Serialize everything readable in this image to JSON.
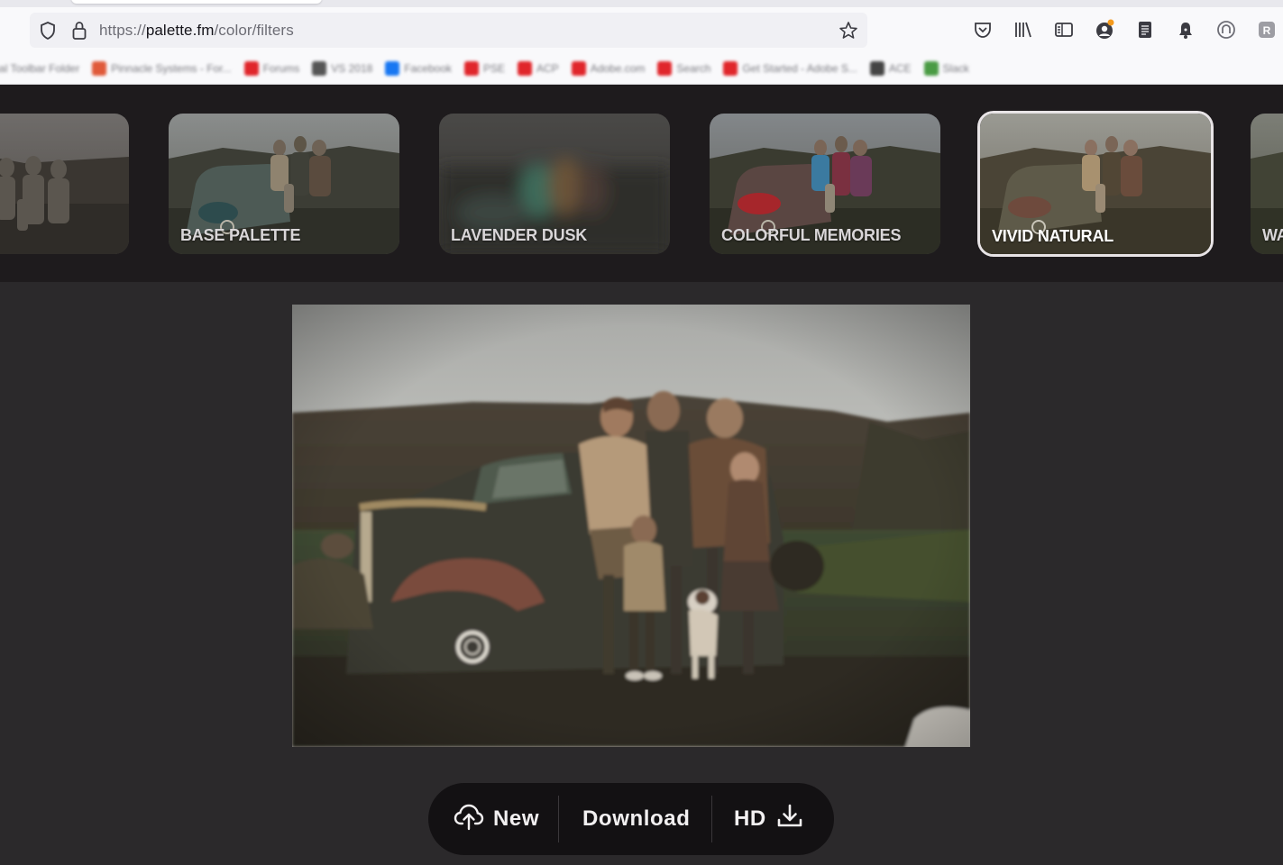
{
  "browser": {
    "url_prefix": "https://",
    "url_domain": "palette.fm",
    "url_path": "/color/filters",
    "icons": [
      "shield-icon",
      "lock-icon",
      "star-icon",
      "pocket-icon",
      "library-icon",
      "sidebar-icon",
      "account-icon",
      "reader-icon",
      "notification-icon",
      "extension-icon",
      "profile-icon"
    ],
    "bookmarks": [
      {
        "label": "Personal Toolbar Folder",
        "color": "#8a8a8a"
      },
      {
        "label": "Pinnacle Systems - For...",
        "color": "#e05a3a"
      },
      {
        "label": "Forums",
        "color": "#e0262b"
      },
      {
        "label": "VS 2018",
        "color": "#555555"
      },
      {
        "label": "Facebook",
        "color": "#1877f2"
      },
      {
        "label": "PSE",
        "color": "#e0262b"
      },
      {
        "label": "ACP",
        "color": "#e0262b"
      },
      {
        "label": "Adobe.com",
        "color": "#e0262b"
      },
      {
        "label": "Search",
        "color": "#e0262b"
      },
      {
        "label": "Get Started - Adobe S...",
        "color": "#e0262b"
      },
      {
        "label": "ACE",
        "color": "#444444"
      },
      {
        "label": "Slack",
        "color": "#4a9b44"
      }
    ]
  },
  "filters": [
    {
      "label": "",
      "selected": false,
      "partial": "left"
    },
    {
      "label": "BASE PALETTE",
      "selected": false
    },
    {
      "label": "LAVENDER DUSK",
      "selected": false
    },
    {
      "label": "COLORFUL MEMORIES",
      "selected": false
    },
    {
      "label": "VIVID NATURAL",
      "selected": true
    },
    {
      "label": "WA",
      "selected": false,
      "partial": "right"
    }
  ],
  "actions": {
    "new_label": "New",
    "download_label": "Download",
    "hd_label": "HD"
  },
  "colors": {
    "page_bg": "#2b292b",
    "carousel_bg": "#1e1b1d",
    "action_bar_bg": "#131113",
    "selected_border": "#e8e4e6"
  }
}
